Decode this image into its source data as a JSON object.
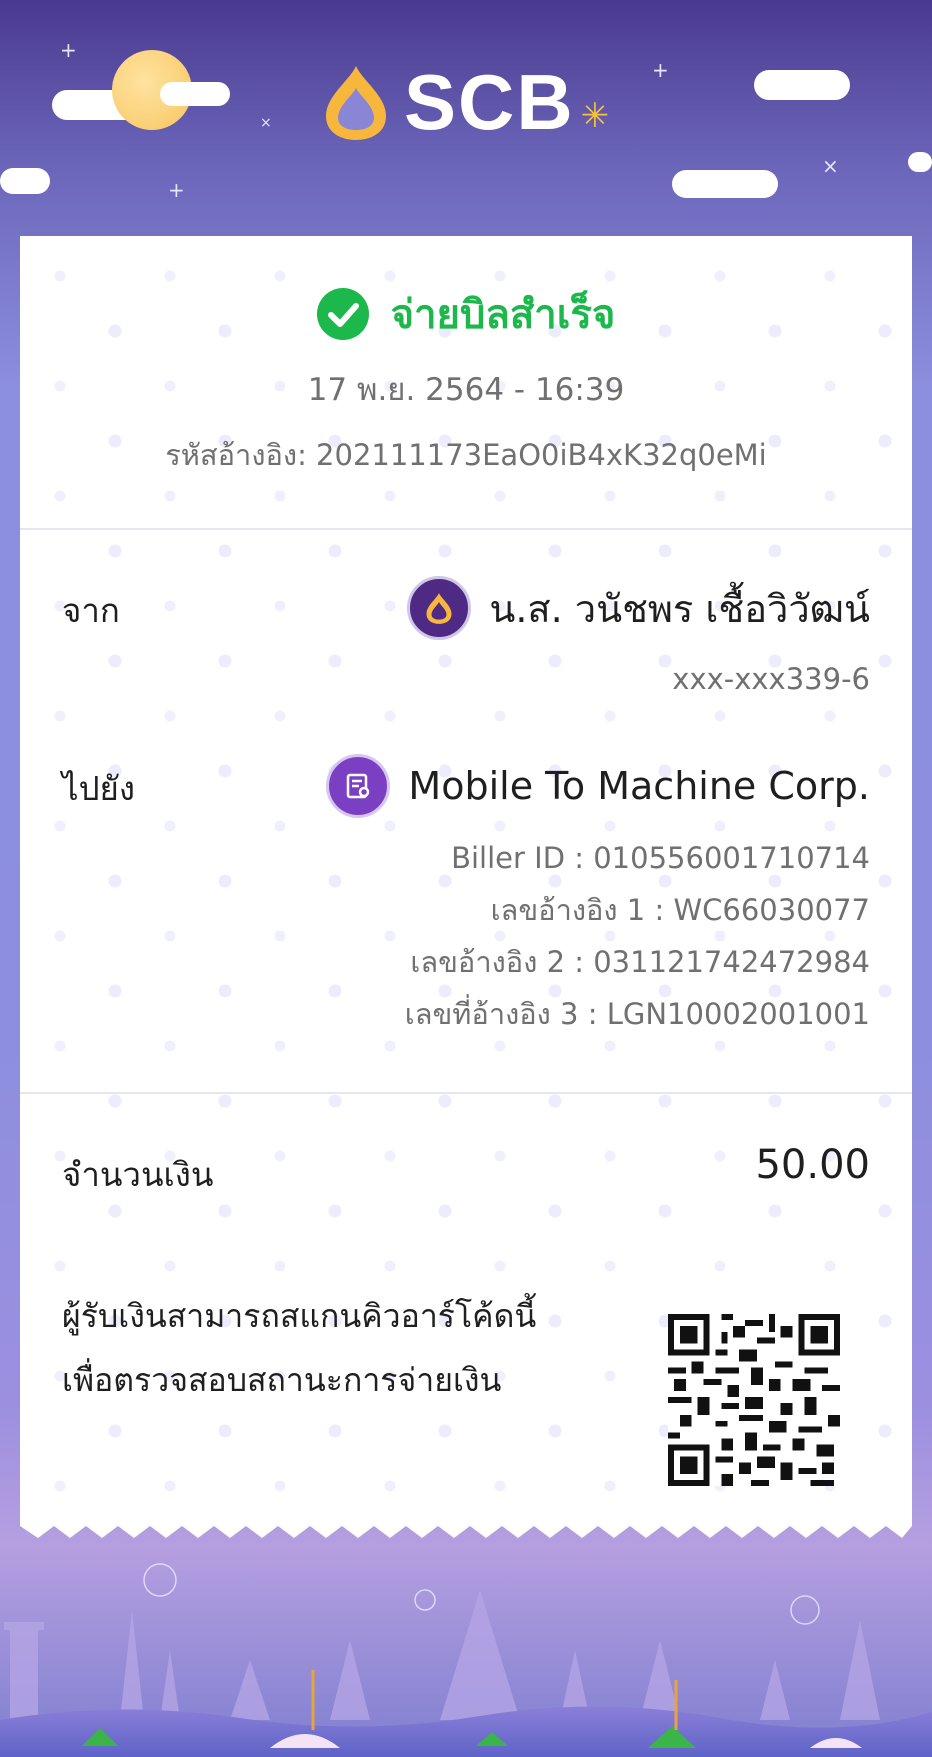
{
  "header": {
    "brand": "SCB",
    "logo_icon": "scb-lotus-logo-icon"
  },
  "status": {
    "icon": "check-circle-icon",
    "title": "จ่ายบิลสำเร็จ",
    "color": "#1cb84c"
  },
  "transaction": {
    "datetime": "17 พ.ย. 2564 - 16:39",
    "reference": "รหัสอ้างอิง: 202111173EaO0iB4xK32q0eMi"
  },
  "from": {
    "label": "จาก",
    "name": "น.ส. วนัชพร เชื้อวิวัฒน์",
    "account": "xxx-xxx339-6",
    "icon": "scb-bank-avatar-icon"
  },
  "to": {
    "label": "ไปยัง",
    "name": "Mobile To Machine Corp.",
    "icon": "biller-avatar-icon",
    "details": [
      "Biller ID : 010556001710714",
      "เลขอ้างอิง 1 : WC66030077",
      "เลขอ้างอิง 2 : 031121742472984",
      "เลขที่อ้างอิง 3 : LGN10002001001"
    ]
  },
  "amount": {
    "label": "จำนวนเงิน",
    "value": "50.00"
  },
  "qr_note": {
    "line1": "ผู้รับเงินสามารถสแกนคิวอาร์โค้ดนี้",
    "line2": "เพื่อตรวจสอบสถานะการจ่ายเงิน",
    "icon": "qr-code-icon"
  },
  "colors": {
    "brand_purple": "#4e2a84",
    "brand_gold": "#f6b73c",
    "success": "#1cb84c"
  }
}
